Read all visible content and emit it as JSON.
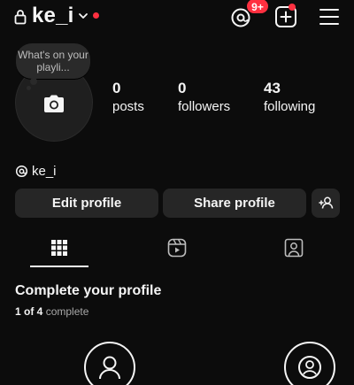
{
  "header": {
    "username": "ke_i",
    "notification_badge": "9+"
  },
  "note": {
    "text": "What's on your playli..."
  },
  "stats": [
    {
      "value": "0",
      "label": "posts"
    },
    {
      "value": "0",
      "label": "followers"
    },
    {
      "value": "43",
      "label": "following"
    }
  ],
  "threads_link": {
    "label": "ke_i"
  },
  "actions": {
    "edit_profile": "Edit profile",
    "share_profile": "Share profile"
  },
  "tabs": [
    {
      "icon": "grid-icon",
      "active": true
    },
    {
      "icon": "reels-icon",
      "active": false
    },
    {
      "icon": "tagged-icon",
      "active": false
    }
  ],
  "complete_profile": {
    "title": "Complete your profile",
    "done": "1 of 4",
    "suffix": "complete"
  },
  "colors": {
    "background": "#0c0c0c",
    "button": "#262626",
    "badge": "#ff3040"
  }
}
